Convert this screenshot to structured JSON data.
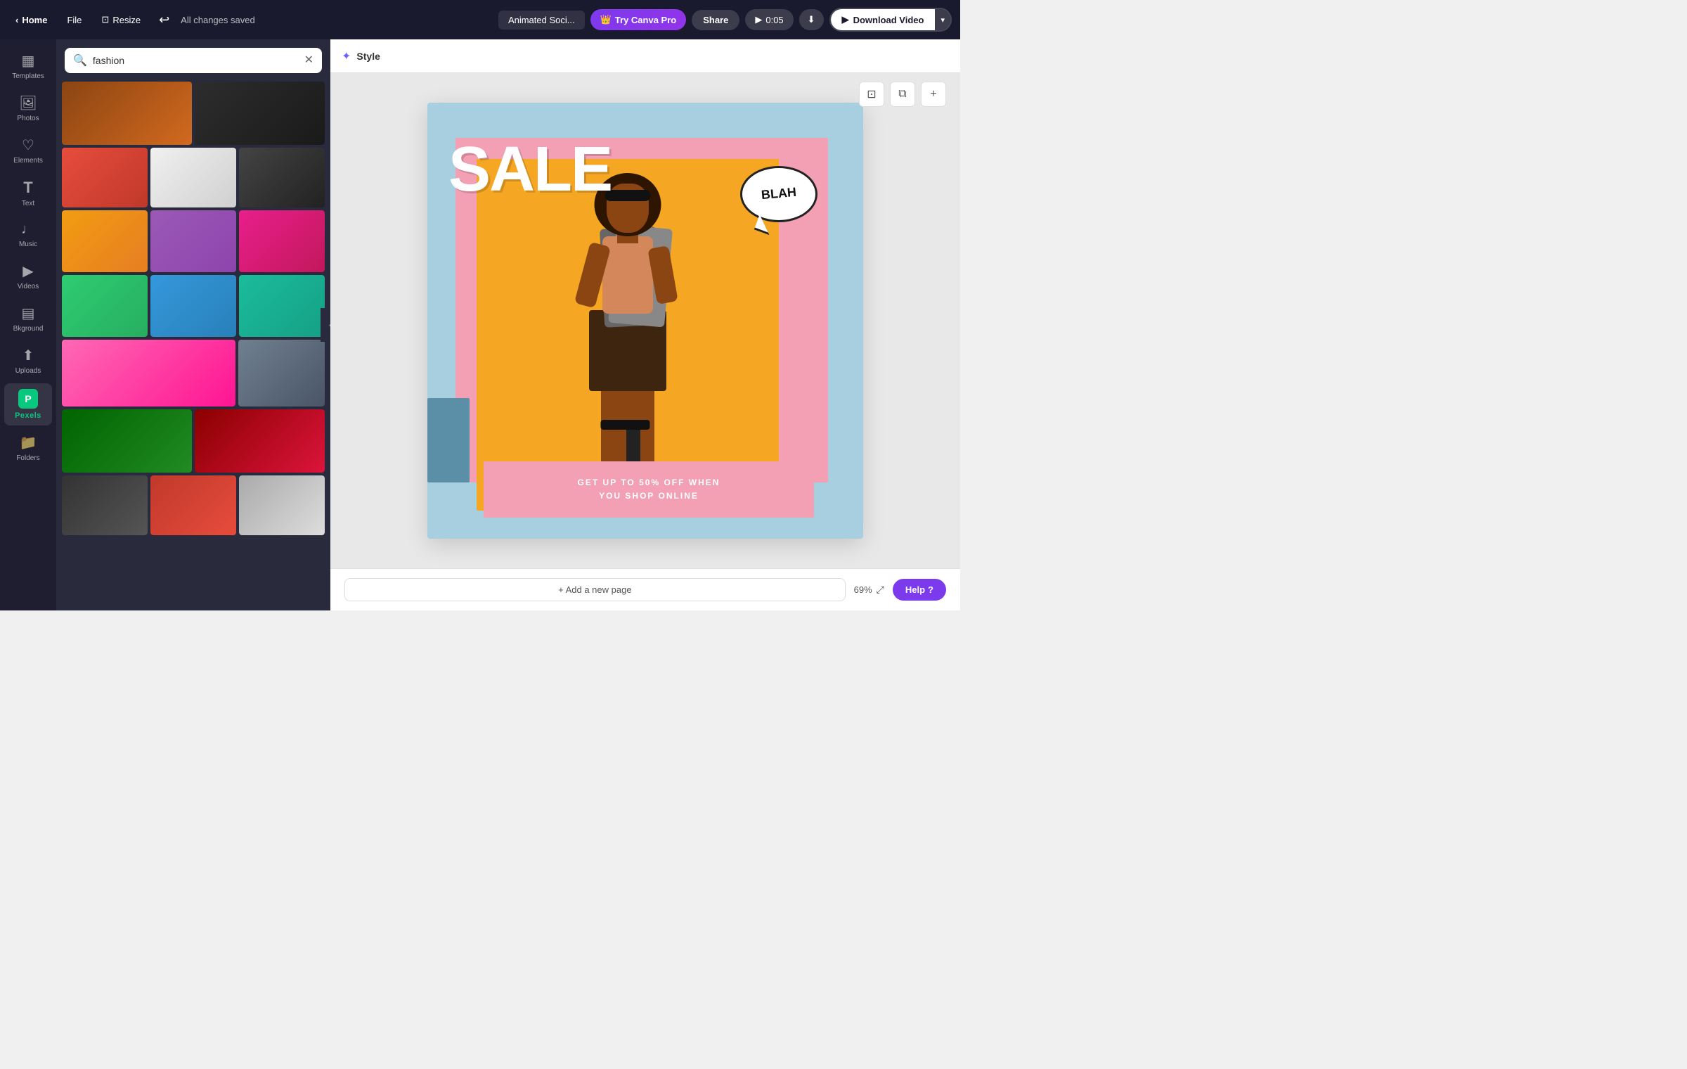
{
  "topnav": {
    "home_label": "Home",
    "file_label": "File",
    "resize_label": "Resize",
    "undo_icon": "↩",
    "all_changes_saved": "All changes saved",
    "project_name": "Animated Soci...",
    "try_pro_label": "Try Canva Pro",
    "share_label": "Share",
    "play_time": "0:05",
    "download_video_label": "Download Video",
    "dropdown_arrow": "▾",
    "crown_icon": "👑"
  },
  "sidebar": {
    "items": [
      {
        "id": "templates",
        "icon": "▦",
        "label": "Templates"
      },
      {
        "id": "photos",
        "icon": "🖼",
        "label": "Photos"
      },
      {
        "id": "elements",
        "icon": "♡",
        "label": "Elements"
      },
      {
        "id": "text",
        "icon": "T",
        "label": "Text"
      },
      {
        "id": "music",
        "icon": "♩",
        "label": "Music"
      },
      {
        "id": "videos",
        "icon": "▶",
        "label": "Videos"
      },
      {
        "id": "background",
        "icon": "▤",
        "label": "Bkground"
      },
      {
        "id": "uploads",
        "icon": "⬆",
        "label": "Uploads"
      },
      {
        "id": "pexels",
        "icon": "P",
        "label": "Pexels"
      },
      {
        "id": "folders",
        "icon": "📁",
        "label": "Folders"
      }
    ]
  },
  "search_panel": {
    "search_placeholder": "fashion",
    "search_icon": "🔍",
    "clear_icon": "✕"
  },
  "style_bar": {
    "style_icon": "✦",
    "style_label": "Style"
  },
  "canvas_toolbar": {
    "resize_icon": "⊡",
    "copy_icon": "⧉",
    "add_icon": "+"
  },
  "design": {
    "sale_text": "SALE",
    "blah_text": "BLAH",
    "bottom_line1": "GET UP TO 50% OFF WHEN",
    "bottom_line2": "YOU SHOP ONLINE",
    "bg_color": "#a8cfe0",
    "pink_color": "#f4a0b4",
    "yellow_color": "#f5a623"
  },
  "bottom_bar": {
    "add_page_label": "+ Add a new page",
    "zoom_level": "69%",
    "expand_icon": "⤢",
    "help_label": "Help",
    "help_icon": "?"
  }
}
